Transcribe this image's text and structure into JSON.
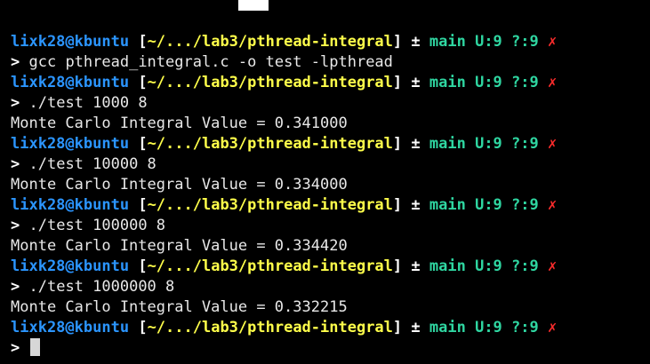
{
  "prompt": {
    "user_host": "lixk28@kbuntu",
    "bracket_open": "[",
    "path": "~/.../lab3/pthread-integral",
    "bracket_close": "]",
    "plusminus": "±",
    "git_status": "main U:9 ?:9",
    "error_mark": "✗",
    "prompt_char": ">"
  },
  "lines": [
    {
      "type": "prompt"
    },
    {
      "type": "cmd",
      "text": "gcc pthread_integral.c -o test -lpthread"
    },
    {
      "type": "prompt"
    },
    {
      "type": "cmd",
      "text": "./test 1000 8"
    },
    {
      "type": "out",
      "text": "Monte Carlo Integral Value = 0.341000"
    },
    {
      "type": "prompt"
    },
    {
      "type": "cmd",
      "text": "./test 10000 8"
    },
    {
      "type": "out",
      "text": "Monte Carlo Integral Value = 0.334000"
    },
    {
      "type": "prompt"
    },
    {
      "type": "cmd",
      "text": "./test 100000 8"
    },
    {
      "type": "out",
      "text": "Monte Carlo Integral Value = 0.334420"
    },
    {
      "type": "prompt"
    },
    {
      "type": "cmd",
      "text": "./test 1000000 8"
    },
    {
      "type": "out",
      "text": "Monte Carlo Integral Value = 0.332215"
    },
    {
      "type": "prompt"
    },
    {
      "type": "cursor"
    }
  ],
  "colors": {
    "background": "#000000",
    "user": "#2b95ff",
    "path": "#ffff4a",
    "branch": "#2fd6a1",
    "error": "#ff2c2c",
    "text": "#e8e8e8"
  }
}
